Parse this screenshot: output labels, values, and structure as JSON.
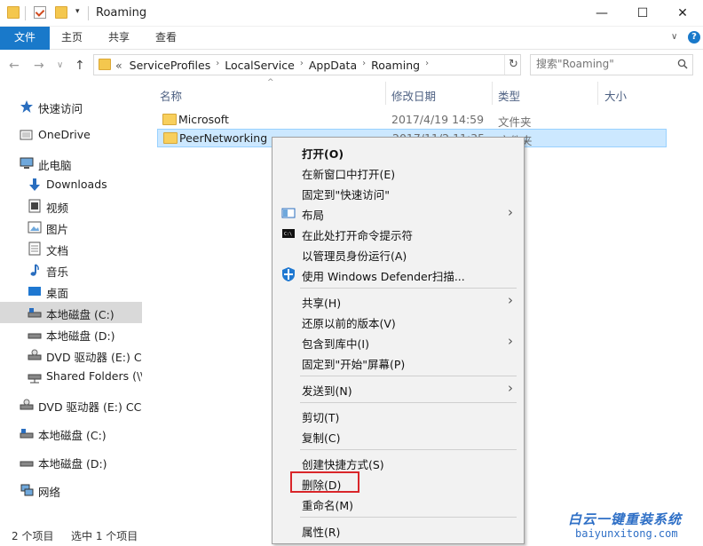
{
  "window": {
    "title": "Roaming",
    "qa_dropdown": "▾",
    "minimize": "—",
    "maximize": "☐",
    "close": "✕"
  },
  "ribbon": {
    "tabs": [
      "文件",
      "主页",
      "共享",
      "查看"
    ],
    "expand": "∨",
    "help": "?"
  },
  "nav": {
    "back": "←",
    "forward": "→",
    "recent": "∨",
    "up": "↑"
  },
  "address": {
    "overflow": "«",
    "breadcrumbs": [
      "ServiceProfiles",
      "LocalService",
      "AppData",
      "Roaming"
    ],
    "separator": "›",
    "dropdown": "∨",
    "refresh": "↻"
  },
  "search": {
    "placeholder": "搜索\"Roaming\""
  },
  "sidebar": {
    "items": [
      {
        "label": "快速访问",
        "icon": "star-icon"
      },
      {
        "label": "OneDrive",
        "icon": "cloud-icon"
      },
      {
        "label": "此电脑",
        "icon": "computer-icon"
      },
      {
        "label": "Downloads",
        "icon": "download-icon"
      },
      {
        "label": "视频",
        "icon": "video-icon"
      },
      {
        "label": "图片",
        "icon": "picture-icon"
      },
      {
        "label": "文档",
        "icon": "document-icon"
      },
      {
        "label": "音乐",
        "icon": "music-icon"
      },
      {
        "label": "桌面",
        "icon": "desktop-icon"
      },
      {
        "label": "本地磁盘 (C:)",
        "icon": "drive-icon"
      },
      {
        "label": "本地磁盘 (D:)",
        "icon": "drive-icon"
      },
      {
        "label": "DVD 驱动器 (E:) CC",
        "icon": "dvd-icon"
      },
      {
        "label": "Shared Folders (\\\\",
        "icon": "network-drive-icon"
      },
      {
        "label": "DVD 驱动器 (E:) CCS",
        "icon": "dvd-icon"
      },
      {
        "label": "本地磁盘 (C:)",
        "icon": "drive-icon"
      },
      {
        "label": "本地磁盘 (D:)",
        "icon": "drive-icon"
      },
      {
        "label": "网络",
        "icon": "network-icon"
      }
    ]
  },
  "filelist": {
    "columns": {
      "name": "名称",
      "date": "修改日期",
      "type": "类型",
      "size": "大小"
    },
    "sort_caret": "^",
    "rows": [
      {
        "name": "Microsoft",
        "date": "2017/4/19 14:59",
        "type": "文件夹"
      },
      {
        "name": "PeerNetworking",
        "date": "2017/11/2 11:35",
        "type": "文件夹"
      }
    ]
  },
  "statusbar": {
    "count": "2 个项目",
    "selected": "选中 1 个项目"
  },
  "context_menu": {
    "items": [
      {
        "label": "打开(O)"
      },
      {
        "label": "在新窗口中打开(E)"
      },
      {
        "label": "固定到\"快速访问\""
      },
      {
        "label": "布局"
      },
      {
        "label": "在此处打开命令提示符"
      },
      {
        "label": "以管理员身份运行(A)"
      },
      {
        "label": "使用 Windows Defender扫描..."
      },
      {
        "label": "共享(H)"
      },
      {
        "label": "还原以前的版本(V)"
      },
      {
        "label": "包含到库中(I)"
      },
      {
        "label": "固定到\"开始\"屏幕(P)"
      },
      {
        "label": "发送到(N)"
      },
      {
        "label": "剪切(T)"
      },
      {
        "label": "复制(C)"
      },
      {
        "label": "创建快捷方式(S)"
      },
      {
        "label": "删除(D)"
      },
      {
        "label": "重命名(M)"
      },
      {
        "label": "属性(R)"
      }
    ],
    "submenu_arrow": "›"
  },
  "watermark": {
    "title": "白云一键重装系统",
    "url": "baiyunxitong.com"
  },
  "colors": {
    "accent": "#1979ca",
    "selection": "#cce8ff",
    "highlight_box": "#d9262a"
  }
}
